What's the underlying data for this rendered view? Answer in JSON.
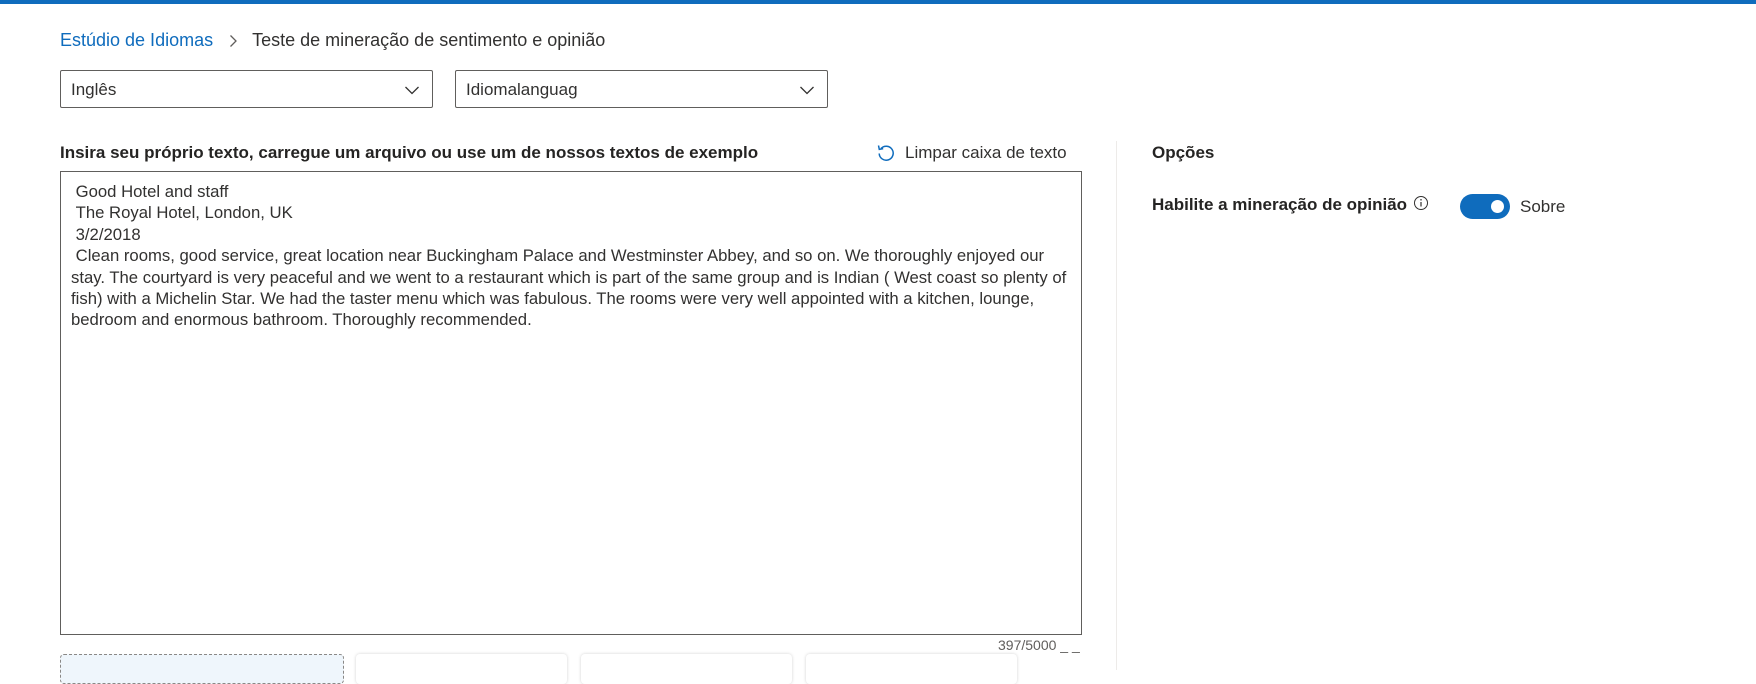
{
  "breadcrumb": {
    "root": "Estúdio de Idiomas",
    "current": "Teste de mineração de sentimento e opinião"
  },
  "dropdowns": {
    "language": {
      "selected": "Inglês"
    },
    "second": {
      "selected": "Idiomalanguag"
    }
  },
  "input": {
    "label": "Insira seu próprio texto, carregue um arquivo ou use um de nossos textos de exemplo",
    "clear_label": "Limpar caixa de texto",
    "text": " Good Hotel and staff\n The Royal Hotel, London, UK\n 3/2/2018\n Clean rooms, good service, great location near Buckingham Palace and Westminster Abbey, and so on. We thoroughly enjoyed our stay. The courtyard is very peaceful and we went to a restaurant which is part of the same group and is Indian ( West coast so plenty of fish) with a Michelin Star. We had the taster menu which was fabulous. The rooms were very well appointed with a kitchen, lounge, bedroom and enormous bathroom. Thoroughly recommended.",
    "char_count": "397/5000 _ _"
  },
  "options": {
    "title": "Opções",
    "opinion_mining_label": "Habilite a mineração de opinião",
    "toggle_state": "Sobre",
    "toggle_on": true
  },
  "icons": {
    "breadcrumb_separator": "chevron-right-icon",
    "dropdown": "chevron-down-icon",
    "clear": "refresh-icon",
    "info": "info-icon"
  },
  "colors": {
    "accent": "#0f6cbd",
    "text": "#323130",
    "border": "#605e5c"
  }
}
